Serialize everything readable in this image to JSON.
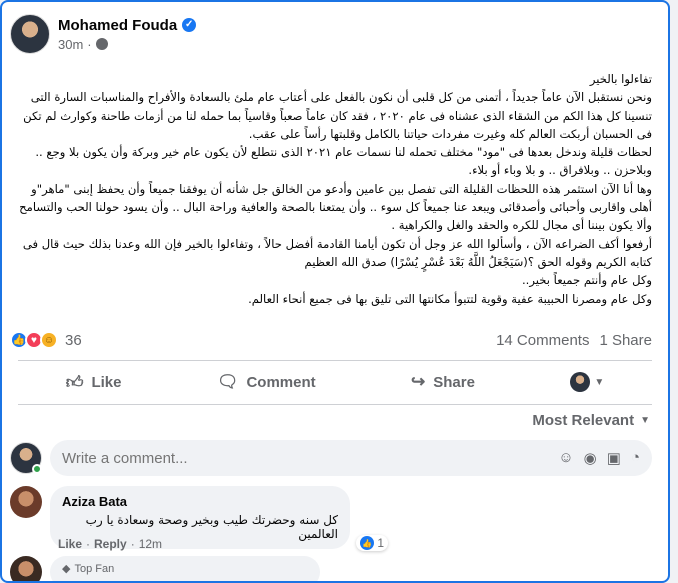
{
  "post": {
    "author": "Mohamed Fouda",
    "time": "30m",
    "paragraphs": [
      "تفاءلوا بالخير",
      "ونحن نستقبل الآن عاماً جديداً ، أتمنى من كل قلبى أن نكون بالفعل على أعتاب عام ملئ بالسعادة والأفراح والمناسبات السارة التى تنسينا كل هذا الكم من الشقاء الذى عشناه فى عام ٢٠٢٠ ، فقد كان عاماً صعباً وقاسياً بما حمله لنا من أزمات طاحنة وكوارث لم تكن فى الحسبان أربكت العالم كله وغيرت مفردات حياتنا بالكامل وقلبتها رأساً على عقب.",
      "لحظات قليلة وندخل بعدها فى \"مود\" مختلف تحمله لنا نسمات عام ٢٠٢١ الذى نتطلع لأن يكون عام خير وبركة وأن يكون بلا وجع .. وبلاحزن .. وبلافراق .. و بلا وباء أو بلاء.",
      "وها أنا الآن استثمر هذه اللحظات القليلة التى تفصل بين عامين وأدعو من الخالق جل شأنه أن يوفقنا جميعاً وأن يحفظ إبنى \"ماهر\"و أهلى واقاربى وأحبائى وأصدقائى ويبعد عنا جميعاً كل سوء .. وأن يمتعنا بالصحة والعافية وراحة البال .. وأن يسود حولنا الحب والتسامح وألا يكون بيننا أى مجال للكره والحقد والغل والكراهية .",
      "أرفعوا أكف الضراعه الآن ، وأسألوا الله عز وجل أن تكون أيامنا القادمة أفضل حالاً ، وتفاءلوا بالخير فإن الله وعدنا بذلك حيث قال فى كتابه الكريم وقوله الحق ؟(سَيَجْعَلُ اللَّهُ بَعْدَ عُسْرٍ يُسْرًا) صدق الله العظيم",
      "وكل عام وأنتم جميعاً بخير..",
      "وكل عام ومصرنا الحبيبة عفية وقوية لتتبوأ مكانتها التى تليق بها فى جميع أنحاء العالم."
    ],
    "reaction_count": "36",
    "comments_count": "14 Comments",
    "shares_count": "1 Share"
  },
  "actions": {
    "like": "Like",
    "comment": "Comment",
    "share": "Share"
  },
  "sort_label": "Most Relevant",
  "composer": {
    "placeholder": "Write a comment..."
  },
  "comments": [
    {
      "name": "Aziza Bata",
      "text": "كل سنه وحضرتك طيب وبخير وصحة وسعادة يا رب العالمين",
      "like": "Like",
      "reply": "Reply",
      "time": "12m",
      "reactions": "1"
    }
  ],
  "next_comment": {
    "badge": "Top Fan"
  },
  "colors": {
    "accent": "#1877f2",
    "secondary_text": "#65676b",
    "bubble": "#f0f2f5"
  }
}
